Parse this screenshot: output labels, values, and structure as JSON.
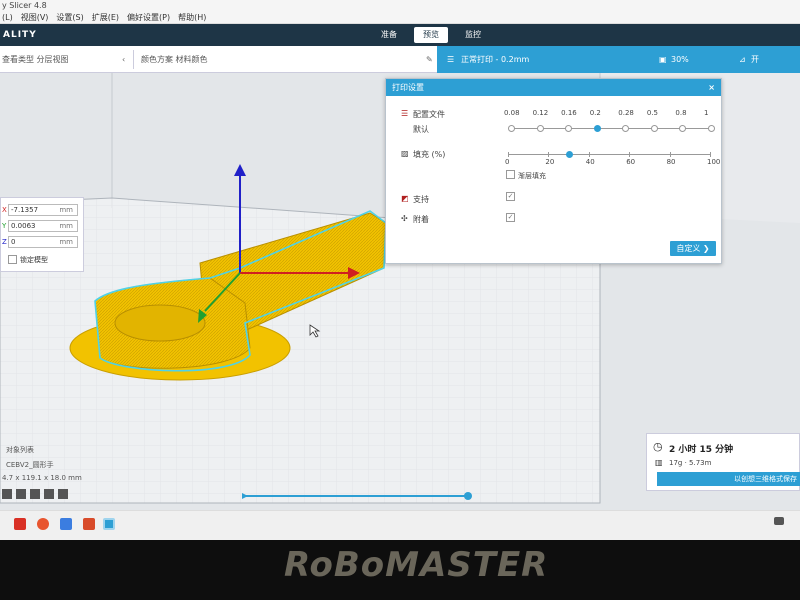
{
  "window": {
    "title": "y Slicer 4.8"
  },
  "menu": {
    "items": [
      "(L)",
      "视图(V)",
      "设置(S)",
      "扩展(E)",
      "偏好设置(P)",
      "帮助(H)"
    ]
  },
  "header": {
    "brand": "ALITY",
    "tabs": [
      {
        "label": "准备",
        "active": false
      },
      {
        "label": "预览",
        "active": true
      },
      {
        "label": "监控",
        "active": false
      }
    ]
  },
  "toolbar": {
    "view_type": "查看类型  分层视图",
    "color_scheme": "颜色方案  材料颜色",
    "profile": "正常打印 - 0.2mm",
    "infill_pct": "30%",
    "support_short": "开"
  },
  "settings": {
    "title": "打印设置",
    "close": "×",
    "profile_label": "配置文件",
    "profile_value": "默认",
    "layer_ticks": [
      "0.08",
      "0.12",
      "0.16",
      "0.2",
      "0.28",
      "0.5",
      "0.8",
      "1"
    ],
    "layer_selected": "0.2",
    "infill_label": "填充 (%)",
    "infill_ticks": [
      "0",
      "20",
      "40",
      "60",
      "80",
      "100"
    ],
    "infill_value": 30,
    "gradual_infill_label": "渐层填充",
    "support_label": "支持",
    "support_checked": true,
    "adhesion_label": "附着",
    "adhesion_checked": true,
    "custom_button": "自定义 ❯"
  },
  "move": {
    "x_label": "X",
    "x_value": "-7.1357",
    "y_label": "Y",
    "y_value": "0.0063",
    "z_label": "Z",
    "z_value": "0",
    "unit": "mm",
    "lock_label": "锁定模型"
  },
  "objects": {
    "title": "对象列表",
    "name": "CEBV2_圆形手",
    "dims": "4.7 x 119.1 x 18.0 mm"
  },
  "estimate": {
    "time": "2 小时 15 分钟",
    "material": "17g · 5.73m",
    "save_button": "以创想三维格式保存"
  },
  "layer_slider": {
    "value": 1.0
  },
  "bezel": {
    "logo": "RoBoMASTER"
  },
  "colors": {
    "accent": "#2d9fd4",
    "header": "#1e3546",
    "model": "#f2c200",
    "outline": "#4fd2e8"
  },
  "icons": {
    "time": "clock-icon",
    "material": "spool-icon",
    "profile": "profile-icon",
    "infill": "infill-icon",
    "support": "support-icon",
    "adhesion": "adhesion-icon"
  }
}
